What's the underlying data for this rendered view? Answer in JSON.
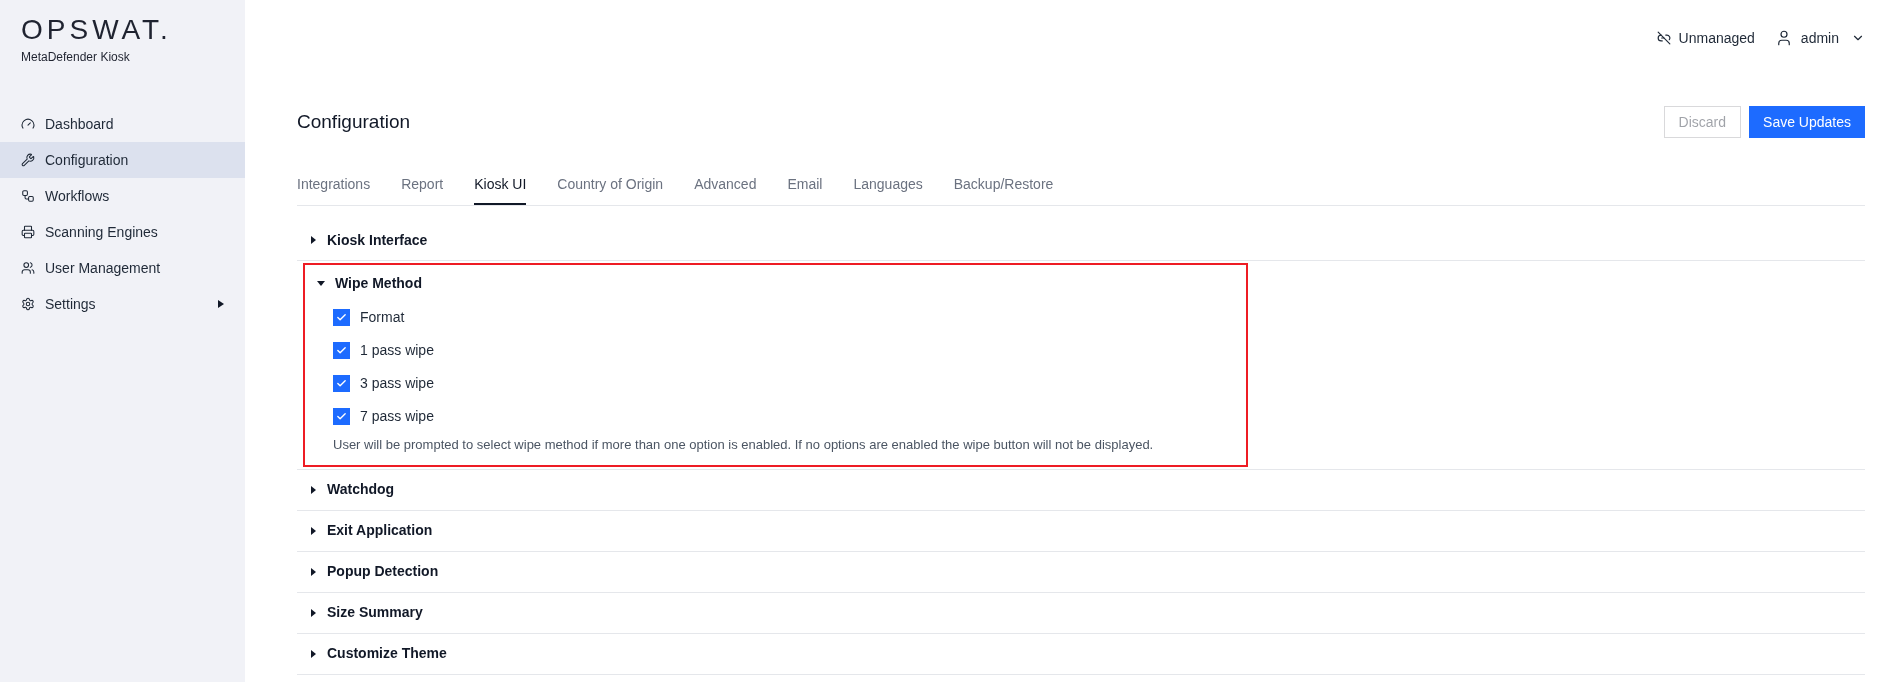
{
  "brand": {
    "logo": "OPSWAT.",
    "product": "MetaDefender Kiosk"
  },
  "sidebar": {
    "items": [
      {
        "label": "Dashboard",
        "selected": false,
        "has_submenu": false
      },
      {
        "label": "Configuration",
        "selected": true,
        "has_submenu": false
      },
      {
        "label": "Workflows",
        "selected": false,
        "has_submenu": false
      },
      {
        "label": "Scanning Engines",
        "selected": false,
        "has_submenu": false
      },
      {
        "label": "User Management",
        "selected": false,
        "has_submenu": false
      },
      {
        "label": "Settings",
        "selected": false,
        "has_submenu": true
      }
    ]
  },
  "topbar": {
    "status": "Unmanaged",
    "user": "admin"
  },
  "page": {
    "title": "Configuration",
    "buttons": [
      {
        "label": "Discard",
        "kind": "secondary",
        "disabled": true
      },
      {
        "label": "Save Updates",
        "kind": "primary",
        "disabled": false
      }
    ]
  },
  "tabs": [
    {
      "label": "Integrations",
      "selected": false
    },
    {
      "label": "Report",
      "selected": false
    },
    {
      "label": "Kiosk UI",
      "selected": true
    },
    {
      "label": "Country of Origin",
      "selected": false
    },
    {
      "label": "Advanced",
      "selected": false
    },
    {
      "label": "Email",
      "selected": false
    },
    {
      "label": "Languages",
      "selected": false
    },
    {
      "label": "Backup/Restore",
      "selected": false
    }
  ],
  "sections": [
    {
      "title": "Kiosk Interface",
      "expanded": false,
      "highlighted": false
    },
    {
      "title": "Wipe Method",
      "expanded": true,
      "highlighted": true,
      "options": [
        {
          "label": "Format",
          "checked": true
        },
        {
          "label": "1 pass wipe",
          "checked": true
        },
        {
          "label": "3 pass wipe",
          "checked": true
        },
        {
          "label": "7 pass wipe",
          "checked": true
        }
      ],
      "note": "User will be prompted to select wipe method if more than one option is enabled. If no options are enabled the wipe button will not be displayed."
    },
    {
      "title": "Watchdog",
      "expanded": false,
      "highlighted": false
    },
    {
      "title": "Exit Application",
      "expanded": false,
      "highlighted": false
    },
    {
      "title": "Popup Detection",
      "expanded": false,
      "highlighted": false
    },
    {
      "title": "Size Summary",
      "expanded": false,
      "highlighted": false
    },
    {
      "title": "Customize Theme",
      "expanded": false,
      "highlighted": false
    }
  ]
}
